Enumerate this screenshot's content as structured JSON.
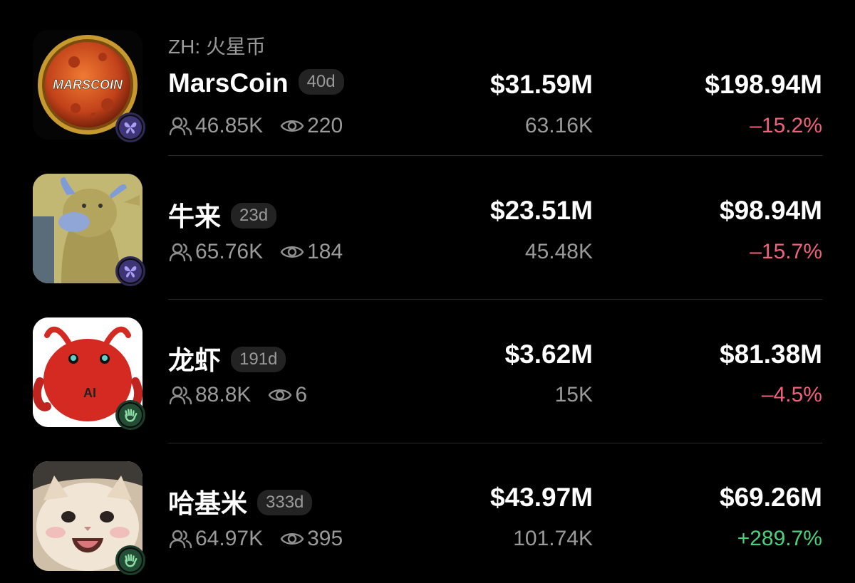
{
  "colors": {
    "background": "#000000",
    "negative": "#f0617a",
    "positive": "#4cd17a",
    "muted": "#9a9a9a"
  },
  "tokens": [
    {
      "subtitle": "ZH: 火星币",
      "name": "MarsCoin",
      "age": "40d",
      "holders": "46.85K",
      "views": "220",
      "price": "$31.59M",
      "volume": "63.16K",
      "market_cap": "$198.94M",
      "change": "–15.2%",
      "change_direction": "negative",
      "avatar_text": "MARSCOIN",
      "badge_icon": "butterfly-icon"
    },
    {
      "name": "牛来",
      "age": "23d",
      "holders": "65.76K",
      "views": "184",
      "price": "$23.51M",
      "volume": "45.48K",
      "market_cap": "$98.94M",
      "change": "–15.7%",
      "change_direction": "negative",
      "badge_icon": "butterfly-icon"
    },
    {
      "name": "龙虾",
      "age": "191d",
      "holders": "88.8K",
      "views": "6",
      "price": "$3.62M",
      "volume": "15K",
      "market_cap": "$81.38M",
      "change": "–4.5%",
      "change_direction": "negative",
      "avatar_text": "AI",
      "badge_icon": "wave-hand-icon"
    },
    {
      "name": "哈基米",
      "age": "333d",
      "holders": "64.97K",
      "views": "395",
      "price": "$43.97M",
      "volume": "101.74K",
      "market_cap": "$69.26M",
      "change": "+289.7%",
      "change_direction": "positive",
      "badge_icon": "wave-hand-icon"
    }
  ]
}
